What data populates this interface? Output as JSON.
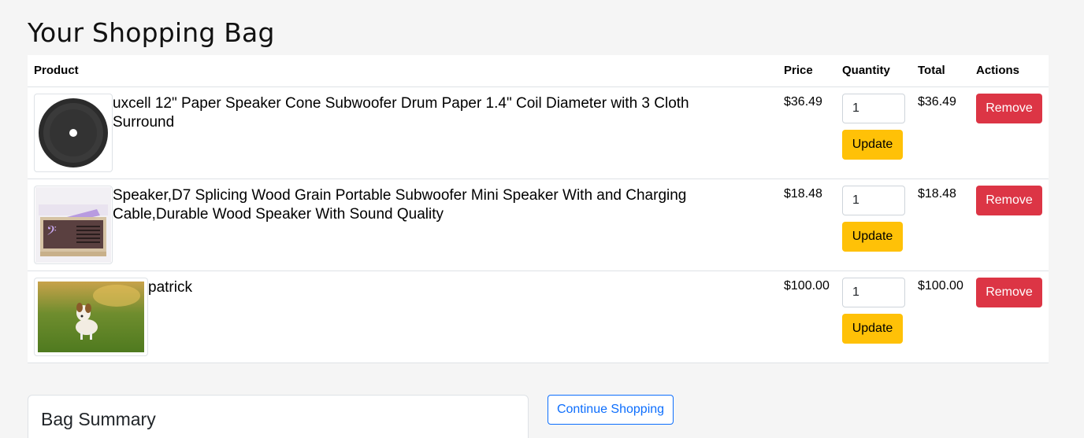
{
  "page": {
    "title": "Your Shopping Bag"
  },
  "table": {
    "headers": {
      "product": "Product",
      "price": "Price",
      "quantity": "Quantity",
      "total": "Total",
      "actions": "Actions"
    },
    "items": [
      {
        "name": "uxcell 12\" Paper Speaker Cone Subwoofer Drum Paper 1.4\" Coil Diameter with 3 Cloth Surround",
        "price": "$36.49",
        "quantity": "1",
        "total": "$36.49",
        "update_label": "Update",
        "remove_label": "Remove",
        "image": "speaker-cone-image"
      },
      {
        "name": "Speaker,D7 Splicing Wood Grain Portable Subwoofer Mini Speaker With and Charging Cable,Durable Wood Speaker With Sound Quality",
        "price": "$18.48",
        "quantity": "1",
        "total": "$18.48",
        "update_label": "Update",
        "remove_label": "Remove",
        "image": "wood-speaker-image"
      },
      {
        "name": "patrick",
        "price": "$100.00",
        "quantity": "1",
        "total": "$100.00",
        "update_label": "Update",
        "remove_label": "Remove",
        "image": "dog-photo-image"
      }
    ]
  },
  "summary": {
    "title": "Bag Summary"
  },
  "actions": {
    "continue_label": "Continue Shopping"
  },
  "colors": {
    "update": "#ffc107",
    "remove": "#dc3545",
    "link": "#0d6efd"
  }
}
